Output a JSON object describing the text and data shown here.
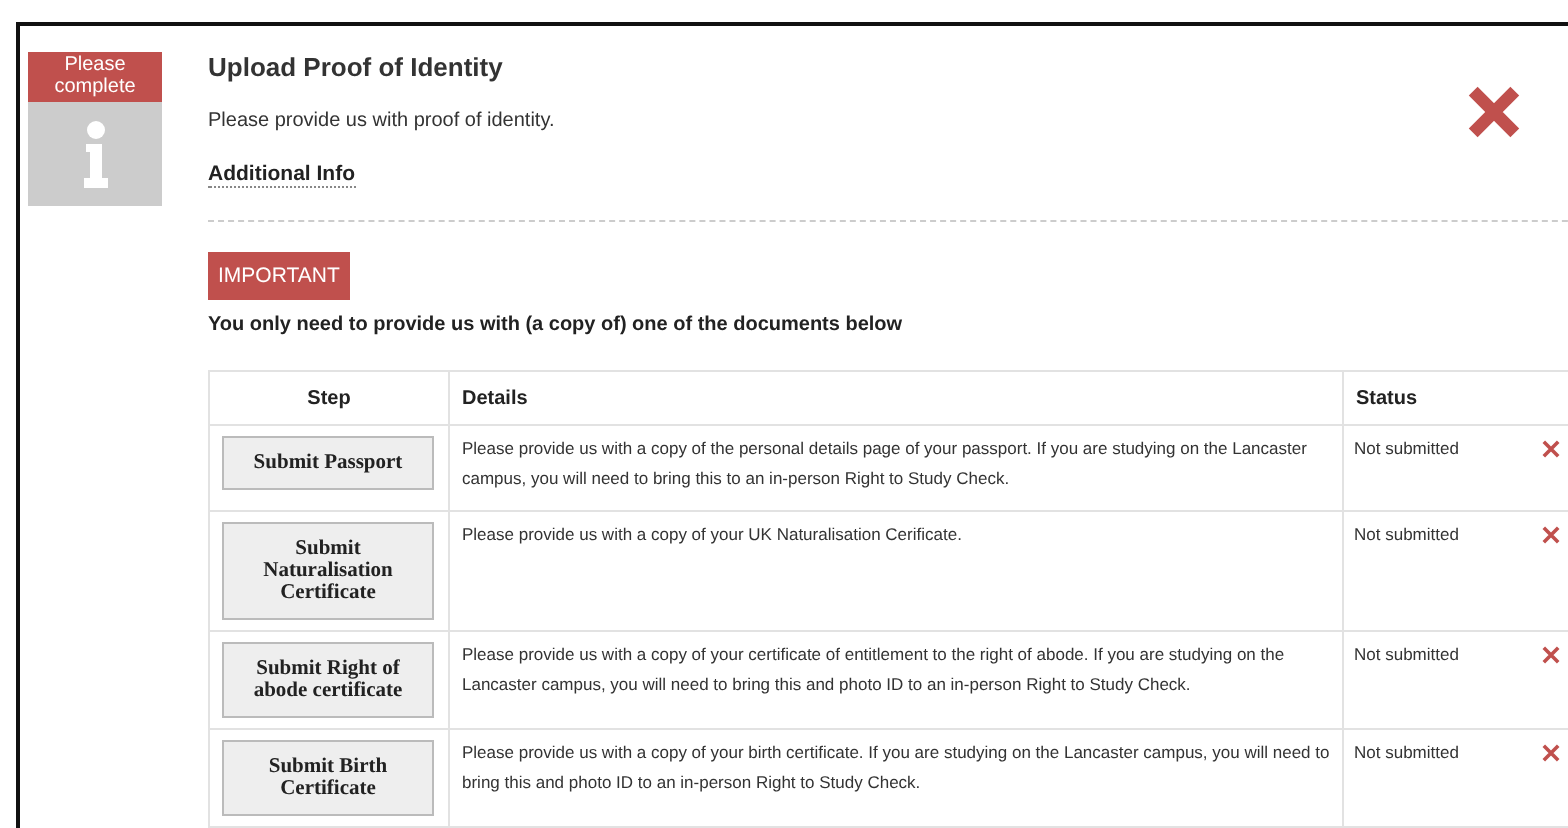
{
  "task": {
    "badge": "Please complete",
    "title": "Upload Proof of Identity",
    "description": "Please provide us with proof of identity.",
    "link": "Additional Info",
    "complete": false
  },
  "notice": {
    "tag": "IMPORTANT",
    "text": "You only need to provide us with (a copy of) one of the documents below"
  },
  "table": {
    "columns": [
      "Step",
      "Details",
      "Status"
    ],
    "rows": [
      {
        "step": "Submit Passport",
        "details": "Please provide us with a copy of the personal details page of your passport. If you are studying on the Lancaster campus, you will need to bring this to an in-person Right to Study Check.",
        "status": "Not submitted",
        "submitted": false
      },
      {
        "step": "Submit Naturalisation Certificate",
        "details": "Please provide us with a copy of your UK Naturalisation Cerificate.",
        "status": "Not submitted",
        "submitted": false
      },
      {
        "step": "Submit Right of abode certificate",
        "details": "Please provide us with a copy of your certificate of entitlement to the right of abode. If you are studying on the Lancaster campus, you will need to bring this and photo ID to an in-person Right to Study Check.",
        "status": "Not submitted",
        "submitted": false
      },
      {
        "step": "Submit Birth Certificate",
        "details": "Please provide us with a copy of your birth certificate. If you are studying on the Lancaster campus, you will need to bring this and photo ID to an in-person Right to Study Check.",
        "status": "Not submitted",
        "submitted": false
      }
    ]
  }
}
